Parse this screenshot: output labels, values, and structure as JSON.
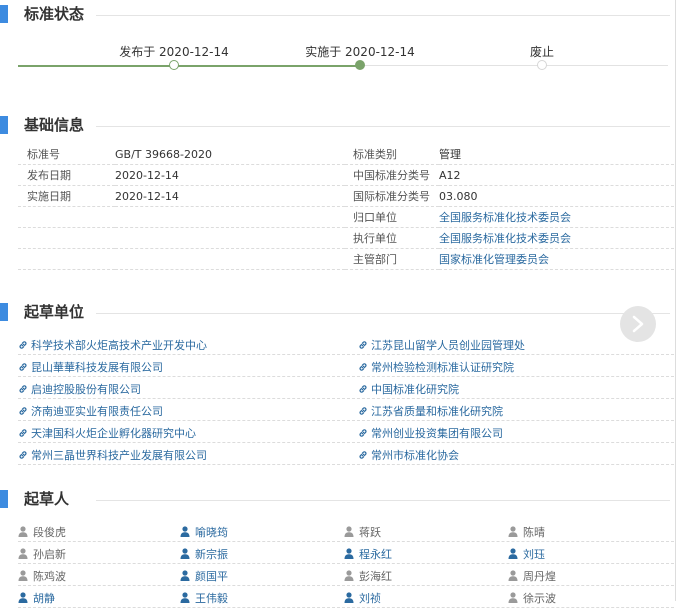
{
  "status": {
    "title": "标准状态",
    "steps": [
      {
        "label": "发布于 2020-12-14",
        "state": "done"
      },
      {
        "label": "实施于 2020-12-14",
        "state": "current"
      },
      {
        "label": "废止",
        "state": "todo"
      }
    ]
  },
  "basic": {
    "title": "基础信息",
    "rows": [
      {
        "k1": "标准号",
        "v1": "GB/T 39668-2020",
        "k2": "标准类别",
        "v2": "管理",
        "link2": false
      },
      {
        "k1": "发布日期",
        "v1": "2020-12-14",
        "k2": "中国标准分类号",
        "v2": "A12",
        "link2": false
      },
      {
        "k1": "实施日期",
        "v1": "2020-12-14",
        "k2": "国际标准分类号",
        "v2": "03.080",
        "link2": false
      },
      {
        "k1": "",
        "v1": "",
        "k2": "归口单位",
        "v2": "全国服务标准化技术委员会",
        "link2": true
      },
      {
        "k1": "",
        "v1": "",
        "k2": "执行单位",
        "v2": "全国服务标准化技术委员会",
        "link2": true
      },
      {
        "k1": "",
        "v1": "",
        "k2": "主管部门",
        "v2": "国家标准化管理委员会",
        "link2": true
      }
    ]
  },
  "drafting_units": {
    "title": "起草单位",
    "rows": [
      [
        "科学技术部火炬高技术产业开发中心",
        "江苏昆山留学人员创业园管理处"
      ],
      [
        "昆山華華科技发展有限公司",
        "常州检验检测标准认证研究院"
      ],
      [
        "启迪控股股份有限公司",
        "中国标准化研究院"
      ],
      [
        "济南迪亚实业有限责任公司",
        "江苏省质量和标准化研究院"
      ],
      [
        "天津国科火炬企业孵化器研究中心",
        "常州创业投资集团有限公司"
      ],
      [
        "常州三晶世界科技产业发展有限公司",
        "常州市标准化协会"
      ]
    ]
  },
  "drafters": {
    "title": "起草人",
    "rows": [
      [
        {
          "name": "段俊虎",
          "link": false
        },
        {
          "name": "喻晓筠",
          "link": true
        },
        {
          "name": "蒋跃",
          "link": false
        },
        {
          "name": "陈晴",
          "link": false
        }
      ],
      [
        {
          "name": "孙启新",
          "link": false
        },
        {
          "name": "新宗振",
          "link": true
        },
        {
          "name": "程永红",
          "link": true
        },
        {
          "name": "刘珏",
          "link": true
        }
      ],
      [
        {
          "name": "陈鸡波",
          "link": false
        },
        {
          "name": "颜国平",
          "link": true
        },
        {
          "name": "彭海红",
          "link": false
        },
        {
          "name": "周丹煌",
          "link": false
        }
      ],
      [
        {
          "name": "胡静",
          "link": true
        },
        {
          "name": "王伟毅",
          "link": true
        },
        {
          "name": "刘祯",
          "link": true
        },
        {
          "name": "徐示波",
          "link": false
        }
      ]
    ]
  },
  "colors": {
    "accent": "#3d8be0",
    "progress": "#7aa36a",
    "link": "#2b6aa0"
  },
  "icons": {
    "unit": "link-icon",
    "person": "person-icon",
    "next": "chevron-right-icon"
  }
}
